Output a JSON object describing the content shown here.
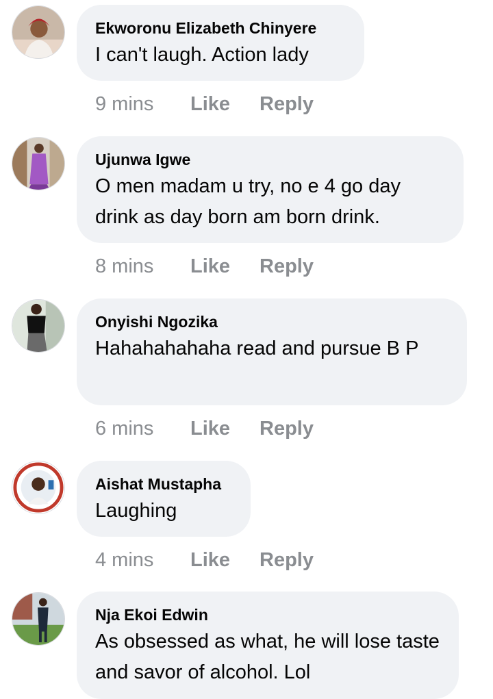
{
  "comments": [
    {
      "author": "Ekworonu Elizabeth Chinyere",
      "text": "I can't laugh. Action lady",
      "time": "9 mins",
      "like_label": "Like",
      "reply_label": "Reply"
    },
    {
      "author": "Ujunwa Igwe",
      "text": "O men madam u try, no e 4 go day drink as day born am born drink.",
      "time": "8 mins",
      "like_label": "Like",
      "reply_label": "Reply"
    },
    {
      "author": "Onyishi Ngozika",
      "text": "Hahahahahaha read and pursue B P",
      "time": "6 mins",
      "like_label": "Like",
      "reply_label": "Reply"
    },
    {
      "author": "Aishat Mustapha",
      "text": "Laughing",
      "time": "4 mins",
      "like_label": "Like",
      "reply_label": "Reply"
    },
    {
      "author": "Nja Ekoi Edwin",
      "text": "As obsessed as what, he will lose taste and savor of alcohol. Lol"
    }
  ],
  "colors": {
    "bubble_background": "#f0f2f5",
    "meta_text": "#8a8d91",
    "primary_text": "#050505"
  }
}
